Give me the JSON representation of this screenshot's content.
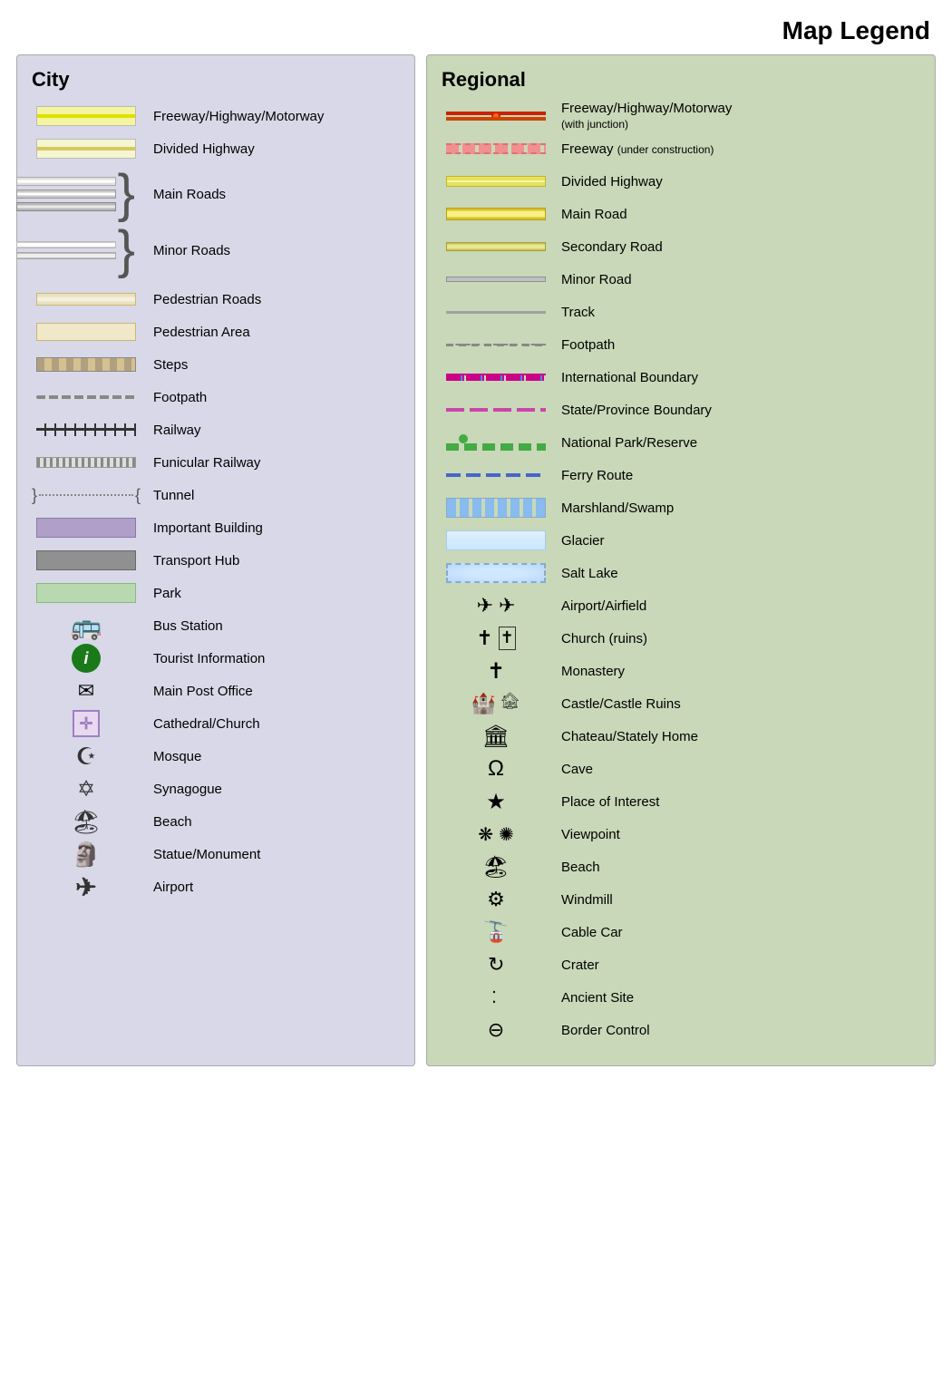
{
  "title": "Map Legend",
  "city": {
    "title": "City",
    "items": [
      {
        "id": "freeway-city",
        "label": "Freeway/Highway/Motorway"
      },
      {
        "id": "divided-hwy-city",
        "label": "Divided Highway"
      },
      {
        "id": "main-roads-city",
        "label": "Main Roads"
      },
      {
        "id": "minor-roads-city",
        "label": "Minor Roads"
      },
      {
        "id": "pedestrian-roads",
        "label": "Pedestrian Roads"
      },
      {
        "id": "pedestrian-area",
        "label": "Pedestrian Area"
      },
      {
        "id": "steps",
        "label": "Steps"
      },
      {
        "id": "footpath-city",
        "label": "Footpath"
      },
      {
        "id": "railway",
        "label": "Railway"
      },
      {
        "id": "funicular",
        "label": "Funicular Railway"
      },
      {
        "id": "tunnel",
        "label": "Tunnel"
      },
      {
        "id": "important-building",
        "label": "Important Building"
      },
      {
        "id": "transport-hub",
        "label": "Transport Hub"
      },
      {
        "id": "park",
        "label": "Park"
      },
      {
        "id": "bus-station",
        "label": "Bus Station"
      },
      {
        "id": "tourist-info",
        "label": "Tourist Information"
      },
      {
        "id": "main-post",
        "label": "Main Post Office"
      },
      {
        "id": "cathedral-church",
        "label": "Cathedral/Church"
      },
      {
        "id": "mosque",
        "label": "Mosque"
      },
      {
        "id": "synagogue",
        "label": "Synagogue"
      },
      {
        "id": "beach-city",
        "label": "Beach"
      },
      {
        "id": "statue-monument",
        "label": "Statue/Monument"
      },
      {
        "id": "airport-city",
        "label": "Airport"
      }
    ]
  },
  "regional": {
    "title": "Regional",
    "items": [
      {
        "id": "fw-junction",
        "label": "Freeway/Highway/Motorway",
        "sublabel": "(with junction)"
      },
      {
        "id": "fw-construction",
        "label": "Freeway",
        "sublabel": "(under construction)"
      },
      {
        "id": "divided-hwy-reg",
        "label": "Divided Highway"
      },
      {
        "id": "main-road-reg",
        "label": "Main Road"
      },
      {
        "id": "secondary-road",
        "label": "Secondary Road"
      },
      {
        "id": "minor-road-reg",
        "label": "Minor Road"
      },
      {
        "id": "track",
        "label": "Track"
      },
      {
        "id": "footpath-reg",
        "label": "Footpath"
      },
      {
        "id": "intl-boundary",
        "label": "International Boundary"
      },
      {
        "id": "state-boundary",
        "label": "State/Province Boundary"
      },
      {
        "id": "nat-park",
        "label": "National Park/Reserve"
      },
      {
        "id": "ferry-route",
        "label": "Ferry Route"
      },
      {
        "id": "marshland",
        "label": "Marshland/Swamp"
      },
      {
        "id": "glacier",
        "label": "Glacier"
      },
      {
        "id": "salt-lake",
        "label": "Salt Lake"
      },
      {
        "id": "airport-reg",
        "label": "Airport/Airfield"
      },
      {
        "id": "church-reg",
        "label": "Church (ruins)"
      },
      {
        "id": "monastery",
        "label": "Monastery"
      },
      {
        "id": "castle",
        "label": "Castle/Castle Ruins"
      },
      {
        "id": "chateau",
        "label": "Chateau/Stately Home"
      },
      {
        "id": "cave",
        "label": "Cave"
      },
      {
        "id": "place-interest",
        "label": "Place of Interest"
      },
      {
        "id": "viewpoint",
        "label": "Viewpoint"
      },
      {
        "id": "beach-reg",
        "label": "Beach"
      },
      {
        "id": "windmill",
        "label": "Windmill"
      },
      {
        "id": "cable-car",
        "label": "Cable Car"
      },
      {
        "id": "crater",
        "label": "Crater"
      },
      {
        "id": "ancient-site",
        "label": "Ancient Site"
      },
      {
        "id": "border-control",
        "label": "Border Control"
      }
    ]
  }
}
